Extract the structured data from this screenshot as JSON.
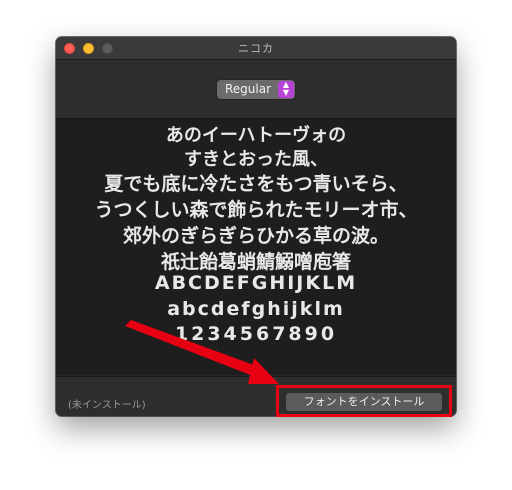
{
  "window": {
    "title": "ニコカ"
  },
  "toolbar": {
    "style_value": "Regular"
  },
  "preview": {
    "lines": [
      "あのイーハトーヴォの",
      "すきとおった風、",
      "夏でも底に冷たさをもつ青いそら、",
      "うつくしい森で飾られたモリーオ市、",
      "郊外のぎらぎらひかる草の波。",
      "祇辻飴葛蛸鯖鰯噌庖箸",
      "ABCDEFGHIJKLM",
      "abcdefghijklm",
      "1234567890"
    ]
  },
  "footer": {
    "status": "(未インストール)",
    "install_label": "フォントをインストール"
  },
  "colors": {
    "annotation_red": "#e60012",
    "popup_accent": "#b443d6"
  }
}
